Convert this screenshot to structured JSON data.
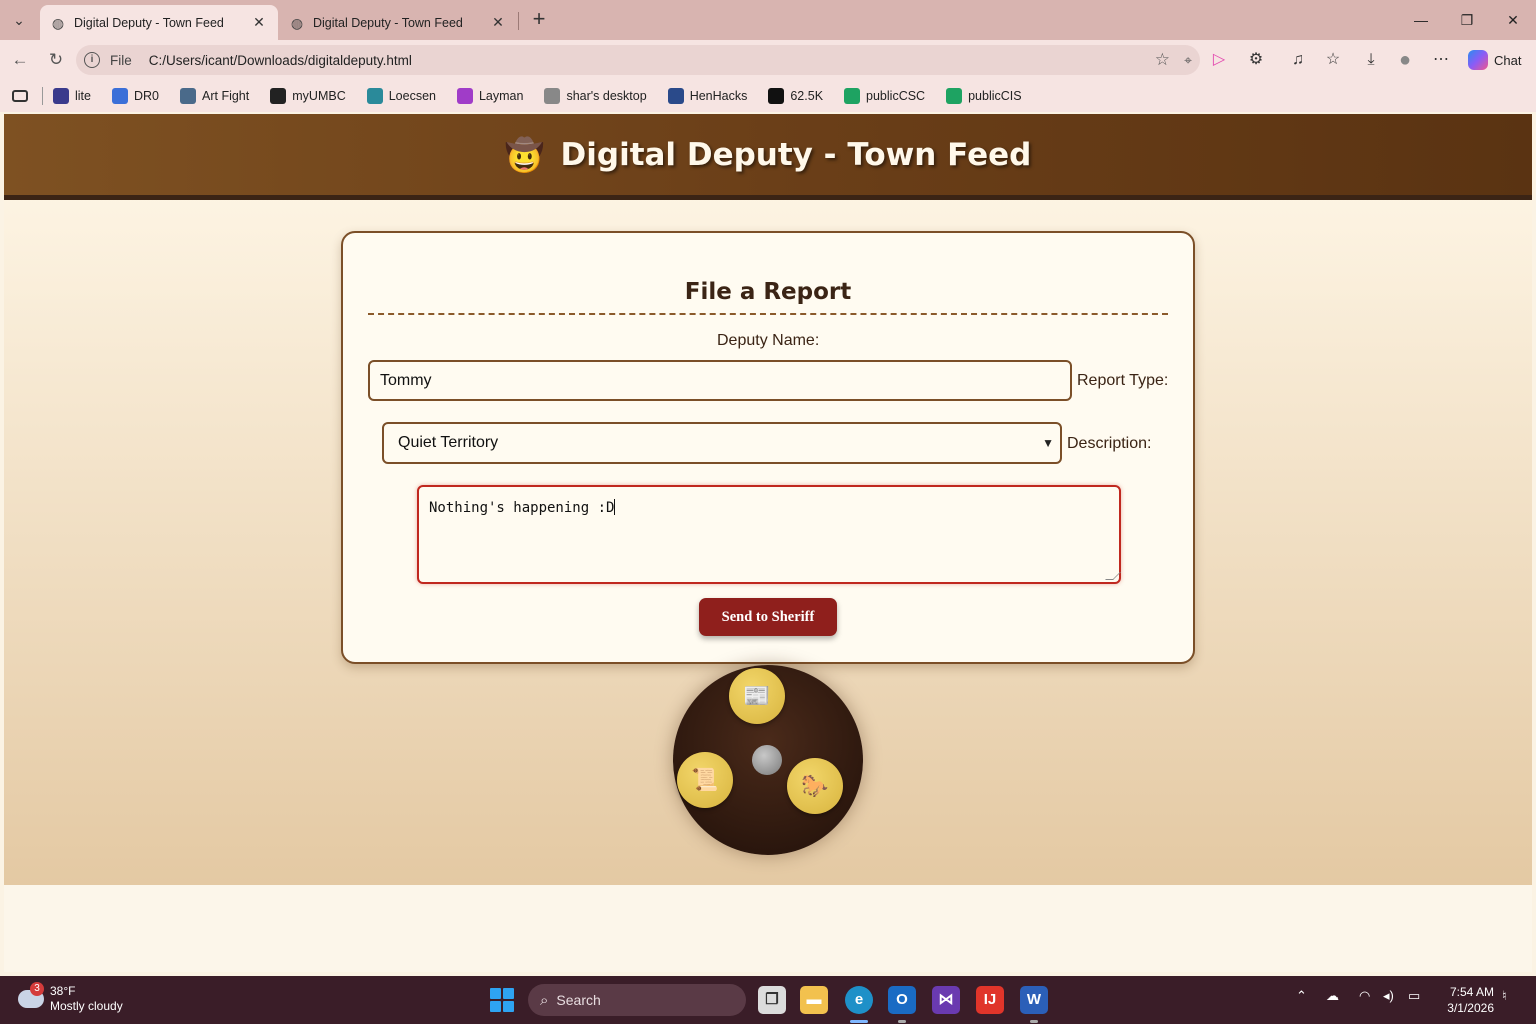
{
  "browser": {
    "tabs": [
      {
        "title": "Digital Deputy - Town Feed",
        "active": true
      },
      {
        "title": "Digital Deputy - Town Feed",
        "active": false
      }
    ],
    "address": {
      "scheme": "File",
      "url": "C:/Users/icant/Downloads/digitaldeputy.html"
    },
    "chat_label": "Chat",
    "bookmarks": [
      {
        "label": "lite",
        "icon": "person-icon",
        "color": "#3a3a8c"
      },
      {
        "label": "DR0",
        "icon": "doc-icon",
        "color": "#3b6fd8"
      },
      {
        "label": "Art Fight",
        "icon": "art-icon",
        "color": "#4a6a8a"
      },
      {
        "label": "myUMBC",
        "icon": "paw-icon",
        "color": "#222222"
      },
      {
        "label": "Loecsen",
        "icon": "loecsen-icon",
        "color": "#2a8a9a"
      },
      {
        "label": "Layman",
        "icon": "star-icon",
        "color": "#a03cc8"
      },
      {
        "label": "shar's desktop",
        "icon": "globe-icon",
        "color": "#888888"
      },
      {
        "label": "HenHacks",
        "icon": "henhacks-icon",
        "color": "#2a4a8a"
      },
      {
        "label": "62.5K",
        "icon": "tiktok-icon",
        "color": "#111111"
      },
      {
        "label": "publicCSC",
        "icon": "drive-icon",
        "color": "#1ea362"
      },
      {
        "label": "publicCIS",
        "icon": "drive-icon",
        "color": "#1ea362"
      }
    ]
  },
  "page": {
    "header_emoji": "🤠",
    "header_title": "Digital Deputy - Town Feed",
    "form": {
      "title": "File a Report",
      "name_label": "Deputy Name:",
      "name_value": "Tommy",
      "type_label": "Report Type:",
      "type_value": "Quiet Territory",
      "description_label": "Description:",
      "description_value": "Nothing's happening :D",
      "submit_label": "Send to Sheriff"
    },
    "wheel": [
      {
        "icon": "reports-icon",
        "glyph": "📰"
      },
      {
        "icon": "notes-icon",
        "glyph": "📜"
      },
      {
        "icon": "horse-icon",
        "glyph": "🐎"
      }
    ]
  },
  "taskbar": {
    "weather_badge": "3",
    "temperature": "38°F",
    "condition": "Mostly cloudy",
    "search_label": "Search",
    "time": "7:54 AM",
    "date": "3/1/2026"
  },
  "colors": {
    "header_brown": "#6b3f18",
    "card_border": "#7b4f28",
    "send_button": "#8f1f1c",
    "taskbar": "#3a1d28"
  }
}
